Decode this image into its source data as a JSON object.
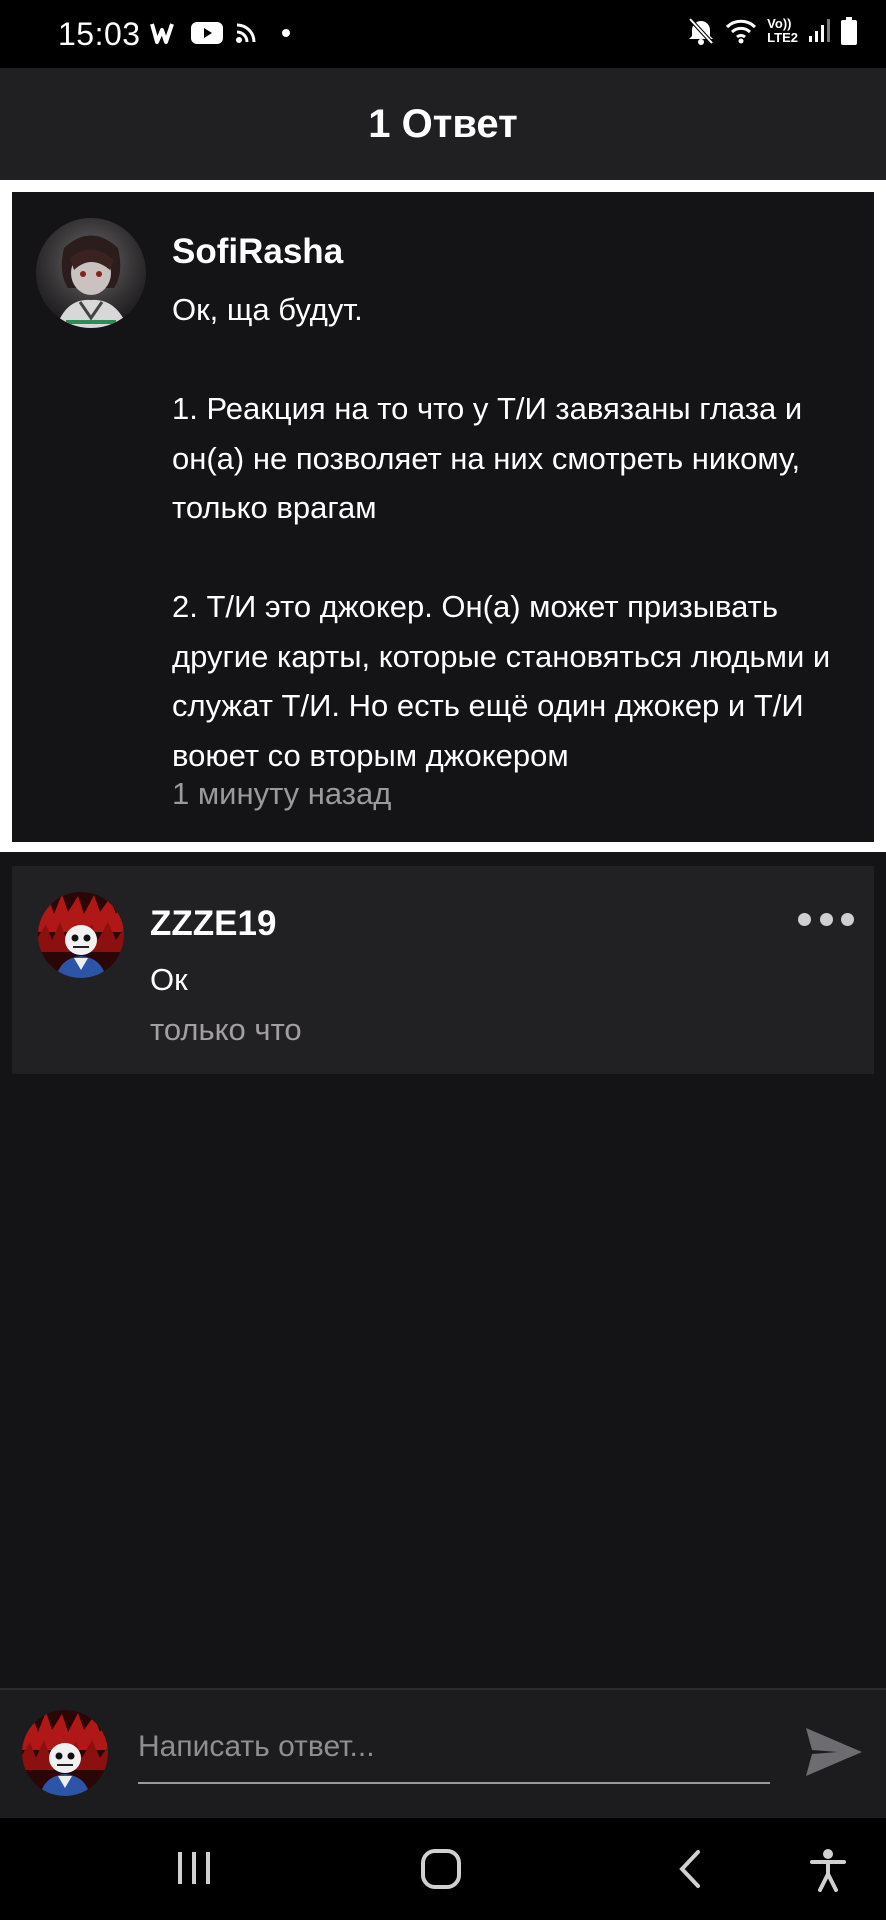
{
  "status_bar": {
    "time": "15:03",
    "left_icons": [
      "wattpad-icon",
      "youtube-icon",
      "rss-icon",
      "notification-dot"
    ],
    "right_icons": [
      "mute-icon",
      "wifi-icon",
      "volte-lte2-icon",
      "signal-icon",
      "battery-icon"
    ],
    "volte_label": "Vo))",
    "lte_label": "LTE2"
  },
  "header": {
    "title": "1 Ответ"
  },
  "parent_comment": {
    "username": "SofiRasha",
    "text": "Ок, ща будут.\n\n1. Реакция на то что у Т/И завязаны глаза и он(а) не позволяет на них смотреть никому, только врагам\n\n2. Т/И это джокер. Он(а) может призывать другие карты, которые становяться людьми и служат Т/И. Но есть ещё один джокер и Т/И воюет со вторым джокером",
    "time": "1 минуту назад"
  },
  "reply": {
    "username": "ZZZE19",
    "text": "Ок",
    "time": "только что"
  },
  "composer": {
    "placeholder": "Написать ответ..."
  },
  "colors": {
    "background": "#141316",
    "card": "#212023",
    "header": "#201f22",
    "muted_text": "#9a999c"
  }
}
